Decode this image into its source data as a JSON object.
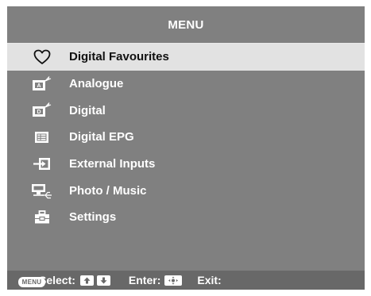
{
  "menu": {
    "title": "MENU",
    "items": [
      {
        "label": "Digital Favourites",
        "icon": "heart-icon",
        "selected": true
      },
      {
        "label": "Analogue",
        "icon": "analogue-tv-icon",
        "badge": "A"
      },
      {
        "label": "Digital",
        "icon": "digital-tv-icon",
        "badge": "D"
      },
      {
        "label": "Digital EPG",
        "icon": "epg-guide-icon"
      },
      {
        "label": "External Inputs",
        "icon": "external-input-icon"
      },
      {
        "label": "Photo / Music",
        "icon": "photo-music-icon"
      },
      {
        "label": "Settings",
        "icon": "settings-toolbox-icon"
      }
    ]
  },
  "footer": {
    "select_label": "Select:",
    "enter_label": "Enter:",
    "exit_label": "Exit:",
    "menu_key_label": "MENU"
  },
  "colors": {
    "panel": "#808080",
    "highlight": "#e2e2e2",
    "footer": "#686868"
  }
}
